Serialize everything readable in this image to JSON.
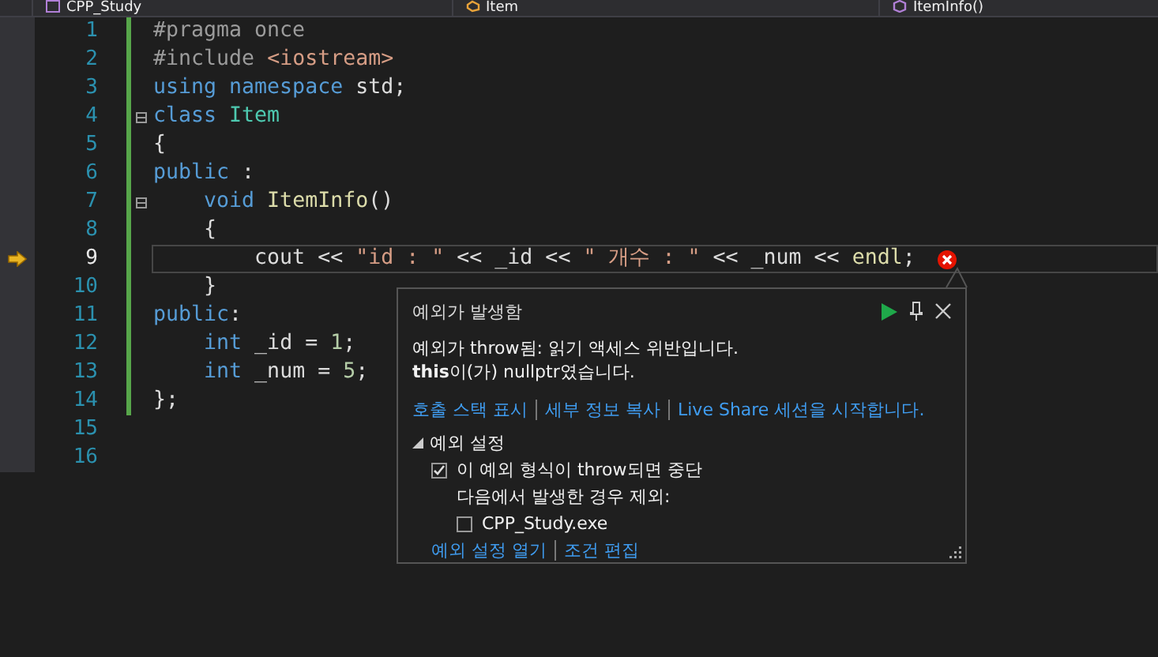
{
  "tabs": [
    {
      "label": "CPP_Study"
    },
    {
      "label": "Item"
    },
    {
      "label": "ItemInfo()"
    }
  ],
  "editor": {
    "lines": [
      {
        "number": "1",
        "changed": true,
        "fold": false,
        "current": false,
        "error": false,
        "tokens": [
          {
            "kind": "preproc",
            "text": "#pragma once"
          }
        ]
      },
      {
        "number": "2",
        "changed": true,
        "fold": false,
        "current": false,
        "error": false,
        "tokens": [
          {
            "kind": "preproc",
            "text": "#include "
          },
          {
            "kind": "string",
            "text": "<iostream>"
          }
        ]
      },
      {
        "number": "3",
        "changed": true,
        "fold": false,
        "current": false,
        "error": false,
        "tokens": [
          {
            "kind": "keyword",
            "text": "using namespace"
          },
          {
            "kind": "plain",
            "text": " std;"
          }
        ]
      },
      {
        "number": "4",
        "changed": true,
        "fold": true,
        "current": false,
        "error": false,
        "tokens": [
          {
            "kind": "keyword",
            "text": "class"
          },
          {
            "kind": "type",
            "text": " Item"
          }
        ]
      },
      {
        "number": "5",
        "changed": true,
        "fold": false,
        "current": false,
        "error": false,
        "tokens": [
          {
            "kind": "plain",
            "text": "{"
          }
        ]
      },
      {
        "number": "6",
        "changed": true,
        "fold": false,
        "current": false,
        "error": false,
        "tokens": [
          {
            "kind": "keyword",
            "text": "public"
          },
          {
            "kind": "plain",
            "text": " :"
          }
        ]
      },
      {
        "number": "7",
        "changed": true,
        "fold": true,
        "current": false,
        "error": false,
        "tokens": [
          {
            "kind": "keyword",
            "text": "    void"
          },
          {
            "kind": "function",
            "text": " ItemInfo"
          },
          {
            "kind": "plain",
            "text": "()"
          }
        ]
      },
      {
        "number": "8",
        "changed": true,
        "fold": false,
        "current": false,
        "error": false,
        "tokens": [
          {
            "kind": "plain",
            "text": "    {"
          }
        ]
      },
      {
        "number": "9",
        "changed": true,
        "fold": false,
        "current": true,
        "error": true,
        "tokens": [
          {
            "kind": "plain",
            "text": "        cout << "
          },
          {
            "kind": "string",
            "text": "\"id : \""
          },
          {
            "kind": "plain",
            "text": " << _id << "
          },
          {
            "kind": "string",
            "text": "\" 개수 : \""
          },
          {
            "kind": "plain",
            "text": " << _num << "
          },
          {
            "kind": "function",
            "text": "endl"
          },
          {
            "kind": "plain",
            "text": ";"
          }
        ]
      },
      {
        "number": "10",
        "changed": true,
        "fold": false,
        "current": false,
        "error": false,
        "tokens": [
          {
            "kind": "plain",
            "text": "    }"
          }
        ]
      },
      {
        "number": "11",
        "changed": true,
        "fold": false,
        "current": false,
        "error": false,
        "tokens": [
          {
            "kind": "keyword",
            "text": "public"
          },
          {
            "kind": "plain",
            "text": ":"
          }
        ]
      },
      {
        "number": "12",
        "changed": true,
        "fold": false,
        "current": false,
        "error": false,
        "tokens": [
          {
            "kind": "keyword",
            "text": "    int"
          },
          {
            "kind": "plain",
            "text": " _id = "
          },
          {
            "kind": "number",
            "text": "1"
          },
          {
            "kind": "plain",
            "text": ";"
          }
        ]
      },
      {
        "number": "13",
        "changed": true,
        "fold": false,
        "current": false,
        "error": false,
        "tokens": [
          {
            "kind": "keyword",
            "text": "    int"
          },
          {
            "kind": "plain",
            "text": " _num = "
          },
          {
            "kind": "number",
            "text": "5"
          },
          {
            "kind": "plain",
            "text": ";"
          }
        ]
      },
      {
        "number": "14",
        "changed": true,
        "fold": false,
        "current": false,
        "error": false,
        "tokens": [
          {
            "kind": "plain",
            "text": "};"
          }
        ]
      },
      {
        "number": "15",
        "changed": false,
        "fold": false,
        "current": false,
        "error": false
      },
      {
        "number": "16",
        "changed": false,
        "fold": false,
        "current": false,
        "error": false
      }
    ]
  },
  "exception_popup": {
    "title": "예외가 발생함",
    "message": [
      "예외가 throw됨: 읽기 액세스 위반입니다.",
      "**this**이(가) nullptr였습니다."
    ],
    "links": [
      "호출 스택 표시",
      "세부 정보 복사",
      "Live Share 세션을 시작합니다."
    ],
    "settings": {
      "heading": "예외 설정",
      "expanded": true,
      "break_option": {
        "label": "이 예외 형식이 throw되면 중단",
        "checked": true
      },
      "except_label": "다음에서 발생한 경우 제외:",
      "modules": [
        {
          "label": "CPP_Study.exe",
          "checked": false
        }
      ],
      "links": [
        "예외 설정 열기",
        "조건 편집"
      ]
    }
  }
}
